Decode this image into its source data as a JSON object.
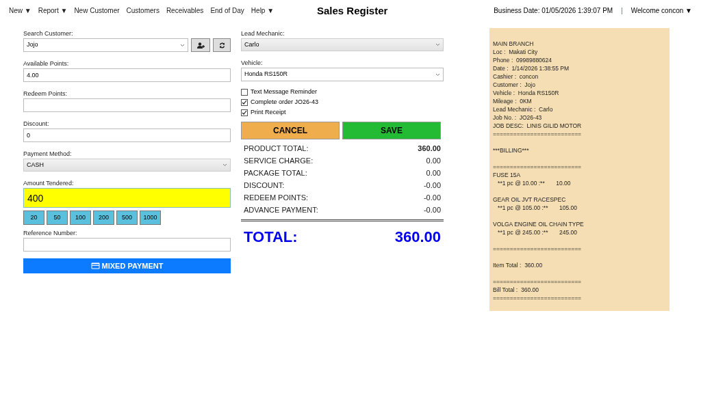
{
  "menu": [
    {
      "label": "New",
      "caret": "▼"
    },
    {
      "label": "Report",
      "caret": "▼"
    },
    {
      "label": "New Customer"
    },
    {
      "label": "Customers"
    },
    {
      "label": "Receivables"
    },
    {
      "label": "End of Day"
    },
    {
      "label": "Help",
      "caret": "▼"
    }
  ],
  "title": "Sales Register",
  "business_date": "Business Date: 01/05/2026 1:39:07 PM",
  "separator": "|",
  "user_menu": {
    "label": "Welcome concon",
    "caret": "▼"
  },
  "left_fields": [
    {
      "label": "Search Customer:",
      "kind": "combo",
      "value": "Jojo"
    },
    {
      "label": "Available Points:",
      "kind": "text",
      "value": "4.00"
    },
    {
      "label": "Redeem Points:",
      "kind": "text"
    },
    {
      "label": "Discount:",
      "kind": "text",
      "value": "0"
    },
    {
      "label": "Payment Method:",
      "kind": "select",
      "value": "CASH"
    },
    {
      "label": "Amount Tendered:",
      "kind": "amount",
      "value": "400"
    },
    {
      "kind": "quick",
      "values": [
        "20",
        "50",
        "100",
        "200",
        "500",
        "1000"
      ]
    },
    {
      "label": "Reference Number:",
      "kind": "text"
    }
  ],
  "mixed_payment": "MIXED PAYMENT",
  "right_fields": [
    {
      "label": "Lead Mechanic:",
      "value": "Carlo"
    },
    {
      "label": "Vehicle:",
      "value": "Honda RS150R"
    }
  ],
  "options": [
    {
      "label": "Text Message Reminder",
      "checked": false
    },
    {
      "label": "Complete order JO26-43",
      "checked": true
    },
    {
      "label": "Print Receipt",
      "checked": true
    }
  ],
  "cancel": "CANCEL",
  "save": "SAVE",
  "summary": [
    {
      "label": "PRODUCT TOTAL:",
      "value": "360.00",
      "bold": true
    },
    {
      "label": "SERVICE CHARGE:",
      "value": "0.00",
      "bold": false
    },
    {
      "label": "PACKAGE TOTAL:",
      "value": "0.00",
      "bold": false
    },
    {
      "label": "DISCOUNT:",
      "value": "-0.00",
      "bold": false
    },
    {
      "label": "REDEEM POINTS:",
      "value": "-0.00",
      "bold": false
    },
    {
      "label": "ADVANCE PAYMENT:",
      "value": "-0.00",
      "bold": false
    }
  ],
  "total": {
    "label": "TOTAL:",
    "value": "360.00"
  },
  "receipt": [
    [
      "MAIN BRANCH",
      "Loc :  Makati City",
      "Phone :  09989880624",
      "Date :  1/14/2026 1:38:55 PM",
      "Cashier :  concon",
      "Customer :  Jojo",
      "Vehicle :  Honda RS150R",
      "Mileage :  0KM",
      "Lead Mechanic :  Carlo",
      "Job No. :  JO26-43",
      "JOB DESC:  LINIS GILID MOTOR",
      "=========================="
    ],
    [
      "***BILLING***"
    ],
    [
      "==========================",
      "FUSE 15A",
      "   **1 pc @ 10.00 :**       10.00"
    ],
    [
      "GEAR OIL JVT RACESPEC",
      "   **1 pc @ 105.00 :**       105.00"
    ],
    [
      "VOLGA ENGINE OIL CHAIN TYPE",
      "   **1 pc @ 245.00 :**       245.00"
    ],
    [
      "=========================="
    ],
    [
      "Item Total :  360.00"
    ],
    [
      "==========================",
      "Bill Total :  360.00",
      "=========================="
    ]
  ]
}
